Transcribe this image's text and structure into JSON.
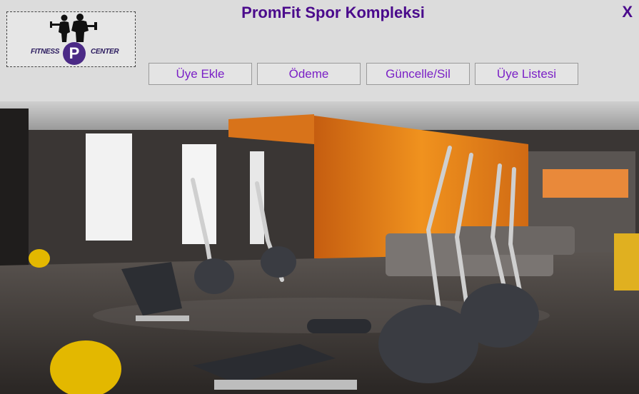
{
  "app": {
    "title": "PromFit Spor Kompleksi",
    "close_label": "X"
  },
  "logo": {
    "left_text": "FITNESS",
    "circle_letter": "P",
    "right_text": "CENTER"
  },
  "toolbar": {
    "buttons": [
      {
        "label": "Üye Ekle"
      },
      {
        "label": "Ödeme"
      },
      {
        "label": "Güncelle/Sil"
      },
      {
        "label": "Üye Listesi"
      }
    ]
  },
  "colors": {
    "accent": "#4a0a8c",
    "button_text": "#7a1fc6",
    "header_bg": "#dcdcdc",
    "gym_orange": "#e8821a"
  },
  "image": {
    "subject": "gym-interior-with-elliptical-machines"
  }
}
